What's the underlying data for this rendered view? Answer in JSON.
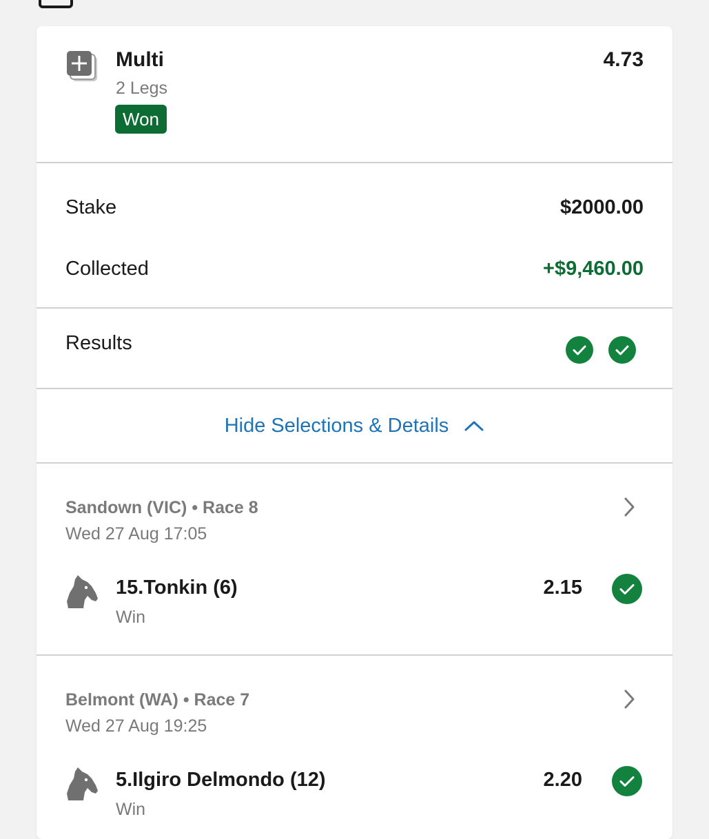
{
  "bet": {
    "title": "Multi",
    "legs_text": "2 Legs",
    "status": "Won",
    "odds": "4.73"
  },
  "summary": {
    "stake_label": "Stake",
    "stake_value": "$2000.00",
    "collected_label": "Collected",
    "collected_value": "+$9,460.00",
    "results_label": "Results",
    "results": [
      "won",
      "won"
    ]
  },
  "toggle": {
    "label": "Hide Selections & Details"
  },
  "legs": [
    {
      "race": "Sandown (VIC) • Race 8",
      "time": "Wed 27 Aug 17:05",
      "runner": "15.Tonkin (6)",
      "market": "Win",
      "odds": "2.15",
      "result": "won"
    },
    {
      "race": "Belmont (WA) • Race 7",
      "time": "Wed 27 Aug 19:25",
      "runner": "5.Ilgiro Delmondo (12)",
      "market": "Win",
      "odds": "2.20",
      "result": "won"
    }
  ],
  "colors": {
    "won_green": "#0d6b34",
    "check_green": "#12823e",
    "link_blue": "#1f73b7",
    "muted_text": "#7a7a7a"
  },
  "icons": {
    "bet_type": "multi-add-icon",
    "horse": "horse-head-icon",
    "result": "check-circle-icon",
    "toggle": "chevron-up-icon",
    "leg_nav": "chevron-right-icon"
  }
}
